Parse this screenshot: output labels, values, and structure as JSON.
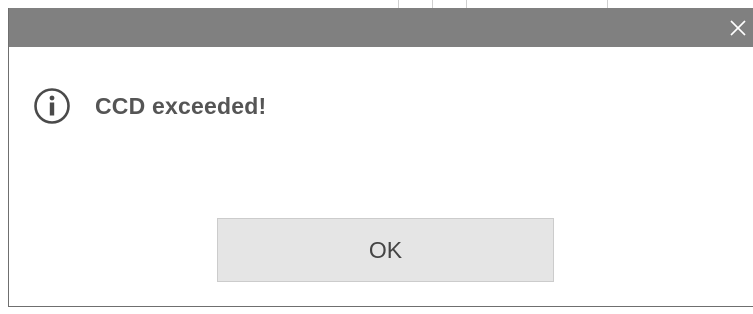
{
  "dialog": {
    "message": "CCD exceeded!",
    "icon": "info-icon",
    "ok_label": "OK",
    "close_icon": "close-icon"
  },
  "colors": {
    "titlebar": "#808080",
    "message_text": "#555555",
    "button_bg": "#e5e5e5",
    "border": "#6f6f6f"
  }
}
